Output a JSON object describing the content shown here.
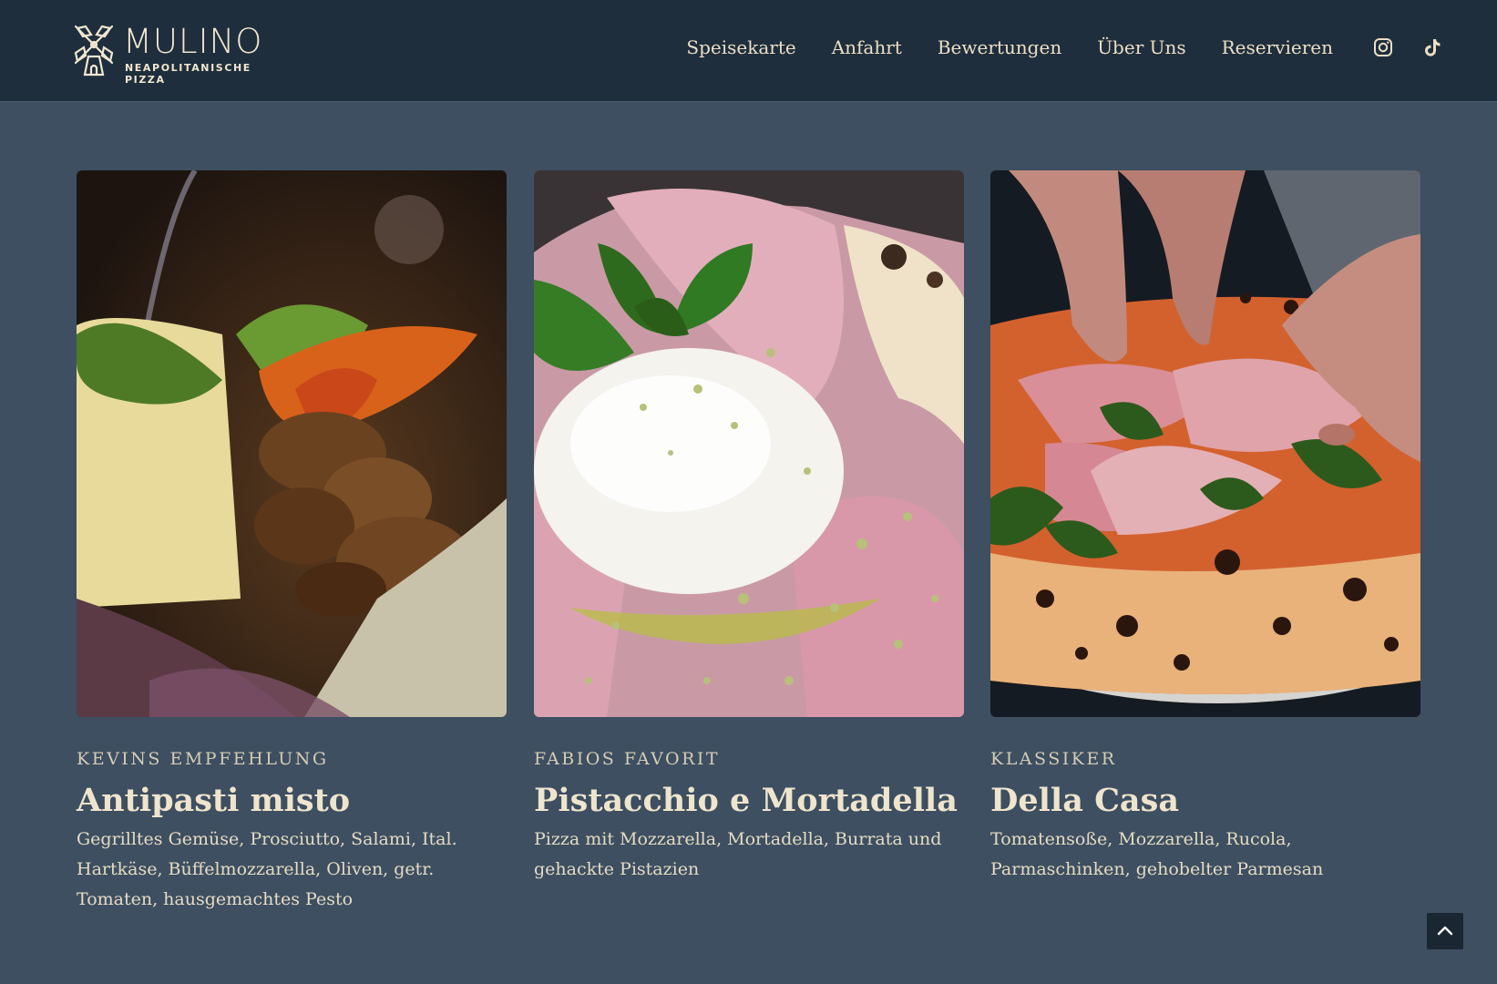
{
  "brand": {
    "name": "MULINO",
    "tagline": "NEAPOLITANISCHE PIZZA",
    "colors": {
      "header_bg": "#1f2e3c",
      "page_bg": "#3d4f61",
      "text": "#e8dcc4"
    }
  },
  "nav": {
    "items": [
      {
        "label": "Speisekarte"
      },
      {
        "label": "Anfahrt"
      },
      {
        "label": "Bewertungen"
      },
      {
        "label": "Über Uns"
      },
      {
        "label": "Reservieren"
      }
    ],
    "social": [
      {
        "icon": "instagram-icon"
      },
      {
        "icon": "tiktok-icon"
      }
    ]
  },
  "cards": [
    {
      "eyebrow": "KEVINS EMPFEHLUNG",
      "title": "Antipasti misto",
      "description": "Gegrilltes Gemüse, Prosciutto, Salami, Ital. Hartkäse, Büffelmozzarella, Oliven, getr. Tomaten, hausgemachtes Pesto",
      "photo_icon": "antipasti-photo"
    },
    {
      "eyebrow": "FABIOS FAVORIT",
      "title": "Pistacchio e Mortadella",
      "description": "Pizza mit Mozzarella, Mortadella, Burrata und gehackte Pistazien",
      "photo_icon": "pistacchio-pizza-photo"
    },
    {
      "eyebrow": "KLASSIKER",
      "title": "Della Casa",
      "description": "Tomatensoße, Mozzarella, Rucola, Parmaschinken, gehobelter Parmesan",
      "photo_icon": "della-casa-pizza-photo"
    }
  ],
  "back_to_top": {
    "icon": "chevron-up-icon"
  }
}
